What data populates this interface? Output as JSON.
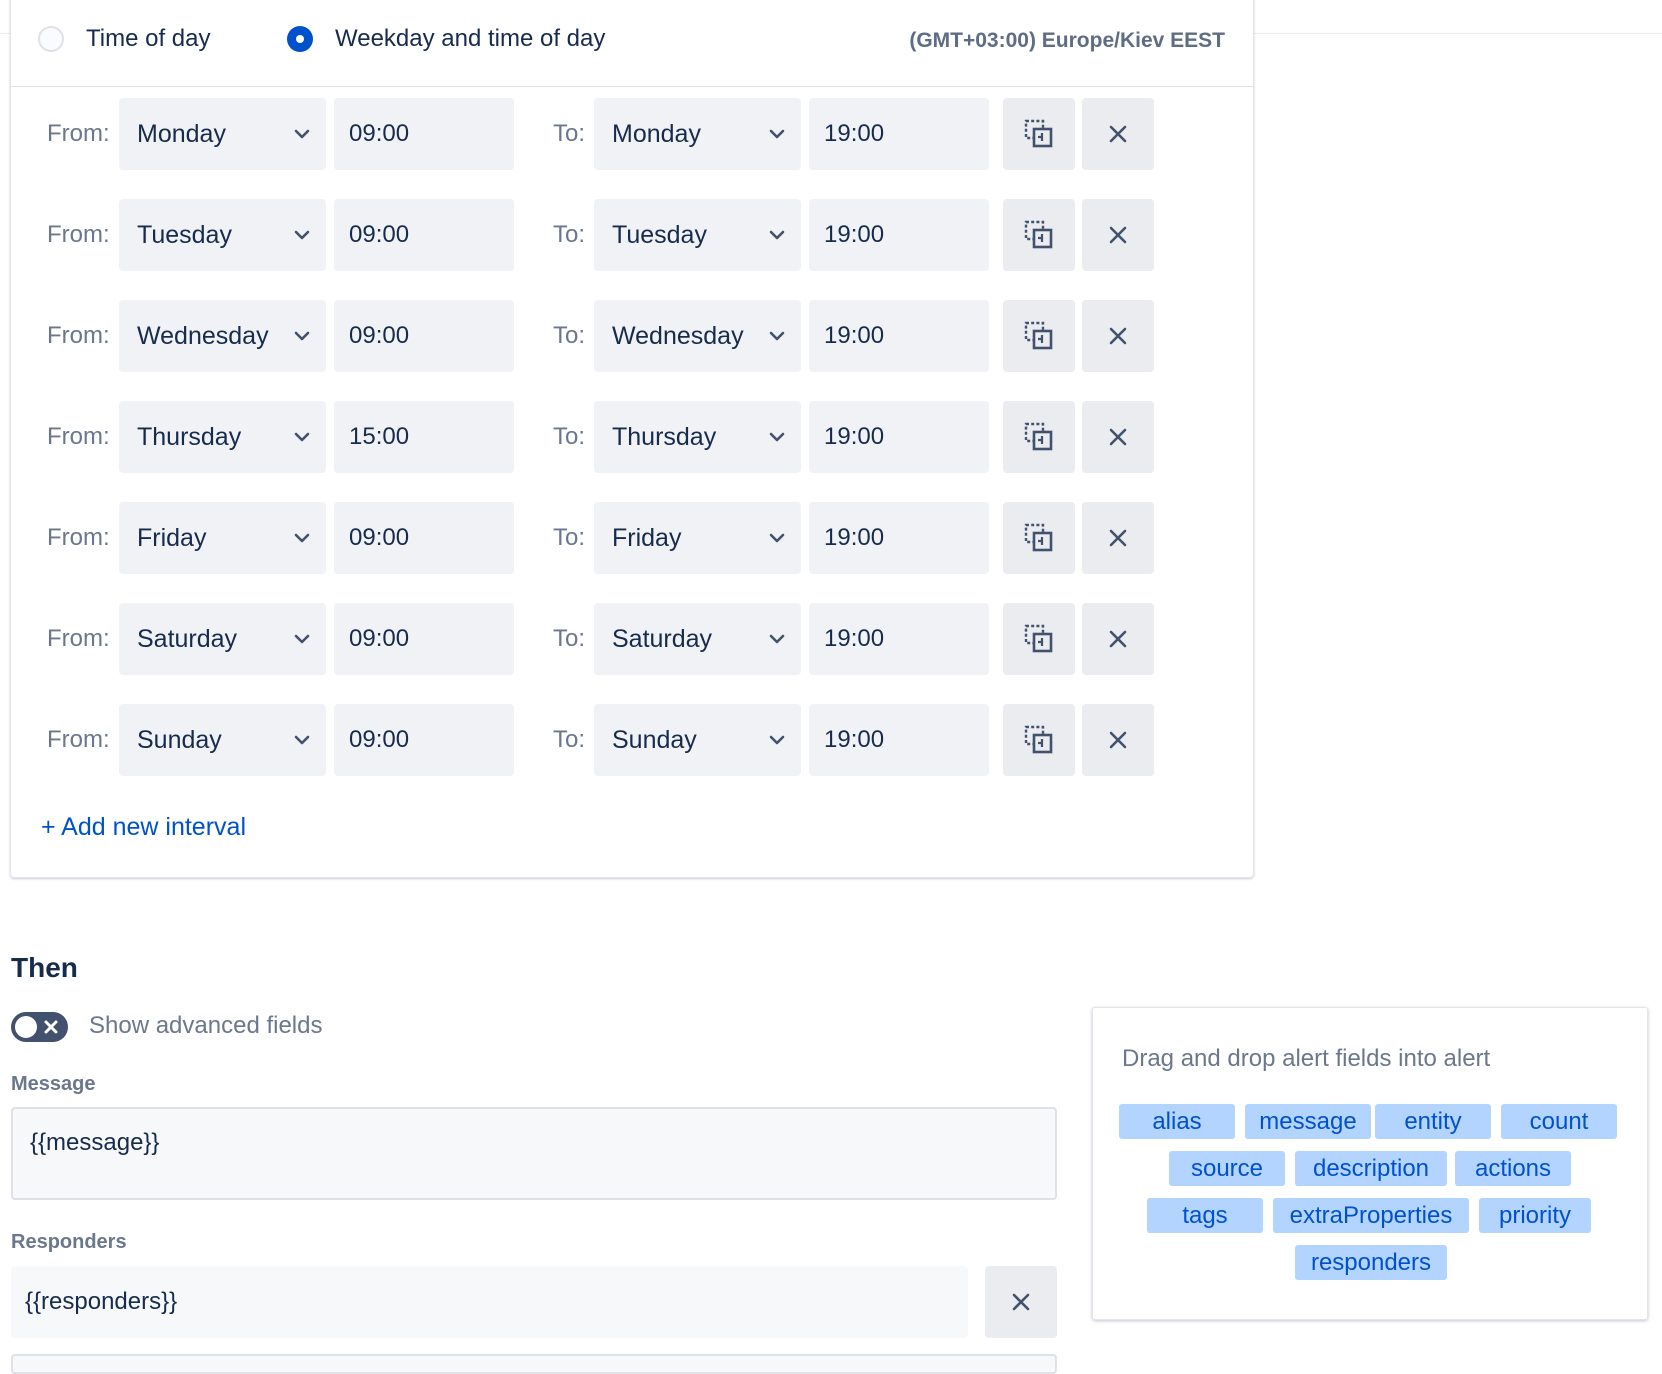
{
  "schedule": {
    "radio_options": [
      {
        "label": "Time of day",
        "checked": false
      },
      {
        "label": "Weekday and time of day",
        "checked": true
      }
    ],
    "timezone": "(GMT+03:00) Europe/Kiev EEST",
    "from_label": "From:",
    "to_label": "To:",
    "intervals": [
      {
        "from_day": "Monday",
        "from_time": "09:00",
        "to_day": "Monday",
        "to_time": "19:00"
      },
      {
        "from_day": "Tuesday",
        "from_time": "09:00",
        "to_day": "Tuesday",
        "to_time": "19:00"
      },
      {
        "from_day": "Wednesday",
        "from_time": "09:00",
        "to_day": "Wednesday",
        "to_time": "19:00"
      },
      {
        "from_day": "Thursday",
        "from_time": "15:00",
        "to_day": "Thursday",
        "to_time": "19:00"
      },
      {
        "from_day": "Friday",
        "from_time": "09:00",
        "to_day": "Friday",
        "to_time": "19:00"
      },
      {
        "from_day": "Saturday",
        "from_time": "09:00",
        "to_day": "Saturday",
        "to_time": "19:00"
      },
      {
        "from_day": "Sunday",
        "from_time": "09:00",
        "to_day": "Sunday",
        "to_time": "19:00"
      }
    ],
    "add_interval_label": "+ Add new interval",
    "icons": {
      "chevron": "chevron-down-icon",
      "duplicate": "duplicate-icon",
      "remove": "close-icon"
    }
  },
  "then": {
    "heading": "Then",
    "advanced_toggle": {
      "label": "Show advanced fields",
      "on": false
    },
    "message": {
      "label": "Message",
      "value": "{{message}}"
    },
    "responders": {
      "label": "Responders",
      "value": "{{responders}}"
    }
  },
  "drag_drop": {
    "title": "Drag and drop alert fields into alert",
    "fields": [
      "alias",
      "message",
      "entity",
      "count",
      "source",
      "description",
      "actions",
      "tags",
      "extraProperties",
      "priority",
      "responders"
    ]
  },
  "colors": {
    "accent": "#0052cc",
    "chip_bg": "#b3d4ff",
    "input_bg": "#f1f2f5",
    "label_gray": "#6b778c",
    "text": "#172b4d"
  }
}
